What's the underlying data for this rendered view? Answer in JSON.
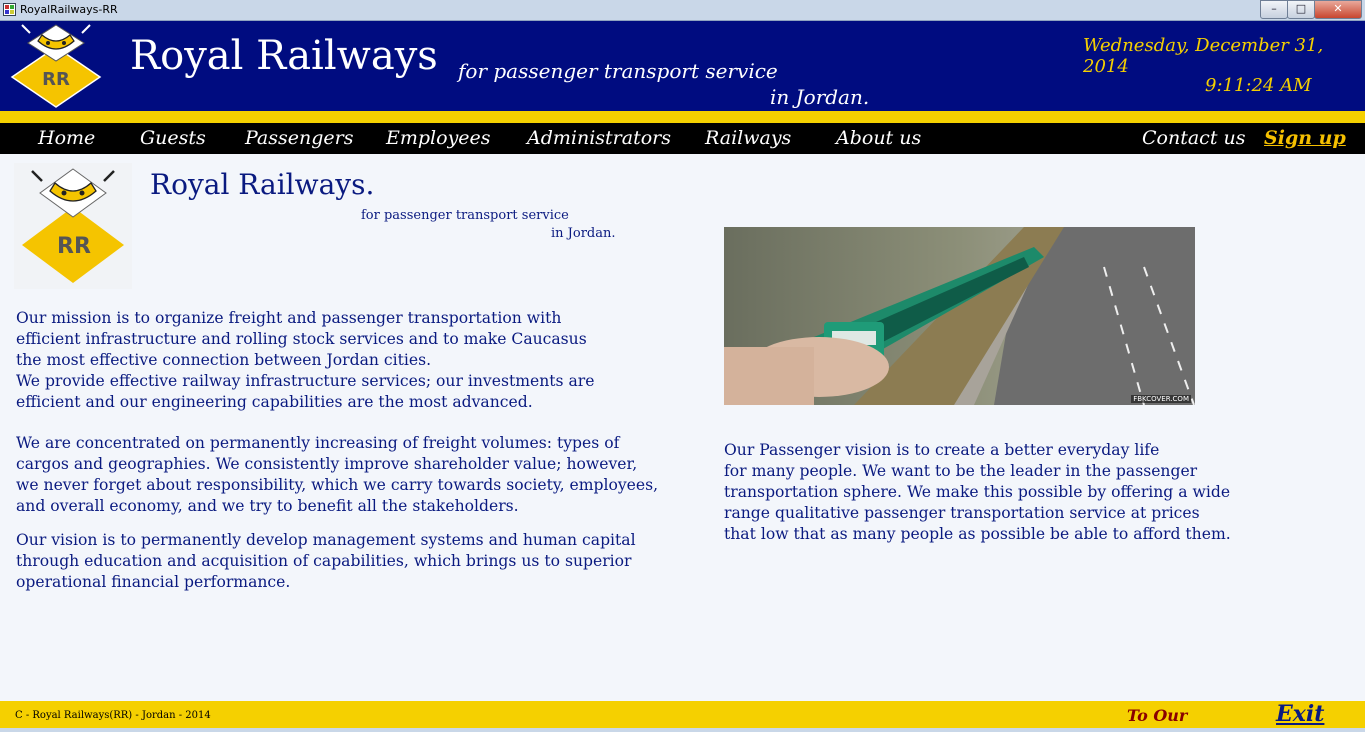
{
  "window": {
    "title": "RoyalRailways-RR",
    "min_label": "–",
    "max_label": "□",
    "close_label": "✕"
  },
  "header": {
    "brand": "Royal Railways",
    "tagline_1": "for passenger transport service",
    "tagline_2": "in Jordan.",
    "date": "Wednesday, December 31, 2014",
    "time": "9:11:24 AM",
    "logo_text": "RR"
  },
  "nav": {
    "home": "Home",
    "guests": "Guests",
    "passengers": "Passengers",
    "employees": "Employees",
    "administrators": "Administrators",
    "railways": "Railways",
    "about": "About us",
    "contact": "Contact us",
    "signup": "Sign up"
  },
  "content": {
    "title": "Royal Railways.",
    "sub_1": "for passenger transport service",
    "sub_2": "in Jordan.",
    "mission_lines": [
      "Our mission  is to organize freight and passenger transportation with",
      "efficient infrastructure and rolling stock services and to make Caucasus",
      "the most effective connection between Jordan cities.",
      "We provide effective railway infrastructure services; our investments are",
      "efficient and our engineering capabilities are the most advanced."
    ],
    "concentrated_lines": [
      "We are concentrated on permanently increasing of freight volumes: types of",
      "cargos and geographies. We consistently improve shareholder value; however,",
      "we never forget about responsibility, which we carry towards society, employees,",
      "and overall economy, and we try to benefit all the stakeholders."
    ],
    "vision_lines": [
      "Our vision is to permanently develop management systems and human capital",
      "through education and acquisition of capabilities, which brings us to superior",
      "operational  financial performance."
    ],
    "photo_credit": "FBKCOVER.COM",
    "passenger_vision_lines": [
      "Our Passenger vision is to create a better everyday life",
      "for many people. We want to be the leader in the passenger",
      "transportation sphere. We make this possible by offering a wide",
      "range qualitative passenger transportation service at prices",
      "that low that as many people as possible be able to afford them."
    ]
  },
  "footer": {
    "copyright": "C - Royal Railways(RR) - Jordan - 2014",
    "to_our": "To Our",
    "exit": "Exit"
  },
  "colors": {
    "header_blue": "#000c80",
    "accent_yellow": "#f5d000",
    "text_navy": "#0a1a80",
    "nav_black": "#000000"
  }
}
